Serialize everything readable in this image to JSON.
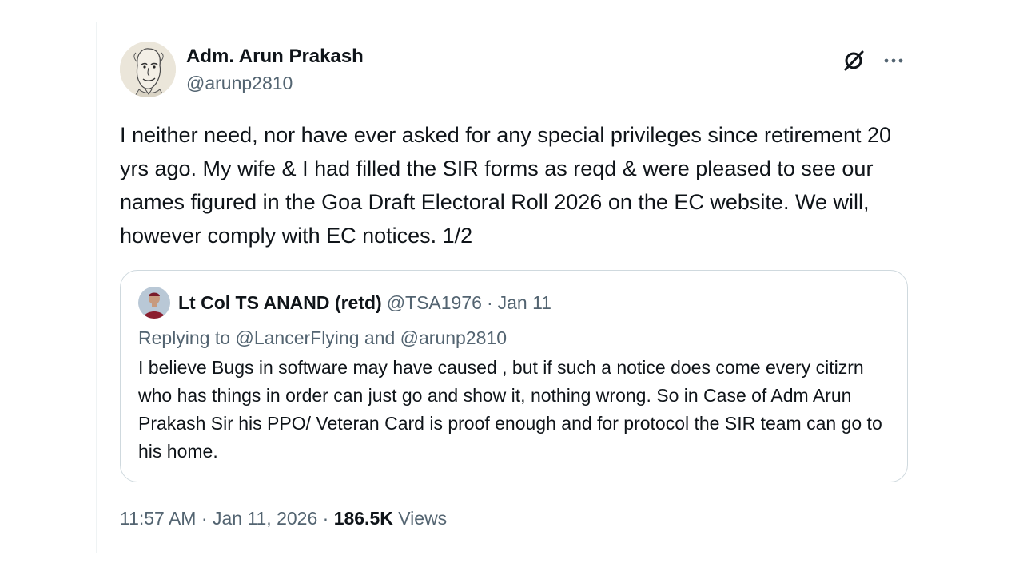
{
  "author": {
    "display_name": "Adm. Arun Prakash",
    "handle": "@arunp2810"
  },
  "tweet": {
    "text": "I neither need, nor have ever asked for any special privileges since retirement 20 yrs ago. My wife & I had filled the SIR forms as reqd & were pleased to see our names figured in the Goa Draft Electoral Roll 2026 on the EC website. We will, however comply with EC notices. 1/2"
  },
  "quote": {
    "display_name": "Lt Col TS ANAND (retd)",
    "handle": "@TSA1976",
    "separator": "·",
    "date": "Jan 11",
    "replying_prefix": "Replying to",
    "replying_mention_1": "@LancerFlying",
    "replying_and": "and",
    "replying_mention_2": "@arunp2810",
    "text": "I believe Bugs in software may have caused , but if such a notice does come every citizrn who has things in order can just go and show it, nothing wrong. So in Case of Adm Arun Prakash Sir his PPO/ Veteran Card is proof enough and for protocol the SIR team can go to his home."
  },
  "footer": {
    "time": "11:57 AM",
    "separator": "·",
    "date": "Jan 11, 2026",
    "views_count": "186.5K",
    "views_label": "Views"
  },
  "icons": {
    "grok": "grok-icon",
    "more": "more-icon"
  }
}
